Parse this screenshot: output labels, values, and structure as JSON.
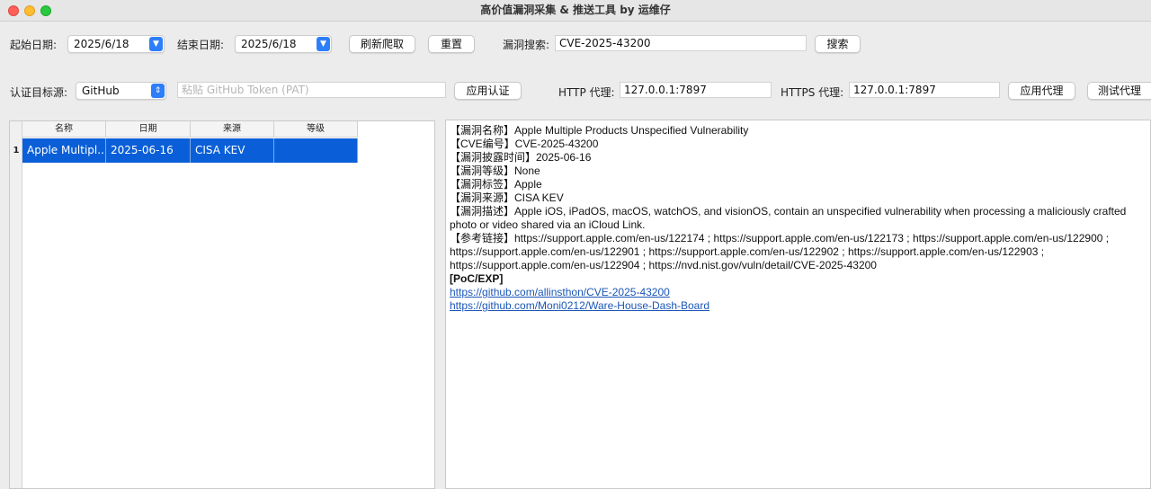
{
  "window": {
    "title": "高价值漏洞采集 & 推送工具 by 运维仔"
  },
  "filters": {
    "start_label": "起始日期:",
    "start_value": "2025/6/18",
    "end_label": "结束日期:",
    "end_value": "2025/6/18",
    "refresh_button": "刷新爬取",
    "reset_button": "重置",
    "search_label": "漏洞搜索:",
    "search_value": "CVE-2025-43200",
    "search_button": "搜索"
  },
  "auth": {
    "source_label": "认证目标源:",
    "source_value": "GitHub",
    "token_placeholder": "粘贴 GitHub Token (PAT)",
    "apply_auth_button": "应用认证",
    "http_label": "HTTP 代理:",
    "http_value": "127.0.0.1:7897",
    "https_label": "HTTPS 代理:",
    "https_value": "127.0.0.1:7897",
    "apply_proxy_button": "应用代理",
    "test_proxy_button": "测试代理"
  },
  "table": {
    "columns": [
      "名称",
      "日期",
      "来源",
      "等级"
    ],
    "rows": [
      {
        "index": "1",
        "name": "Apple Multipl...",
        "date": "2025-06-16",
        "source": "CISA KEV",
        "level": ""
      }
    ]
  },
  "detail": {
    "name_line": "【漏洞名称】Apple Multiple Products Unspecified Vulnerability",
    "cve_line": "【CVE编号】CVE-2025-43200",
    "date_line": "【漏洞披露时间】2025-06-16",
    "level_line": "【漏洞等级】None",
    "tag_line": "【漏洞标签】Apple",
    "source_line": "【漏洞来源】CISA KEV",
    "desc_line": "【漏洞描述】Apple iOS, iPadOS, macOS, watchOS, and visionOS, contain an unspecified vulnerability when processing a maliciously crafted photo or video shared via an iCloud Link.",
    "ref_line": "【参考链接】https://support.apple.com/en-us/122174 ; https://support.apple.com/en-us/122173 ; https://support.apple.com/en-us/122900 ; https://support.apple.com/en-us/122901 ; https://support.apple.com/en-us/122902 ; https://support.apple.com/en-us/122903 ; https://support.apple.com/en-us/122904 ; https://nvd.nist.gov/vuln/detail/CVE-2025-43200",
    "poc_header": "[PoC/EXP]",
    "poc_links": [
      "https://github.com/allinsthon/CVE-2025-43200",
      "https://github.com/Moni0212/Ware-House-Dash-Board"
    ]
  }
}
